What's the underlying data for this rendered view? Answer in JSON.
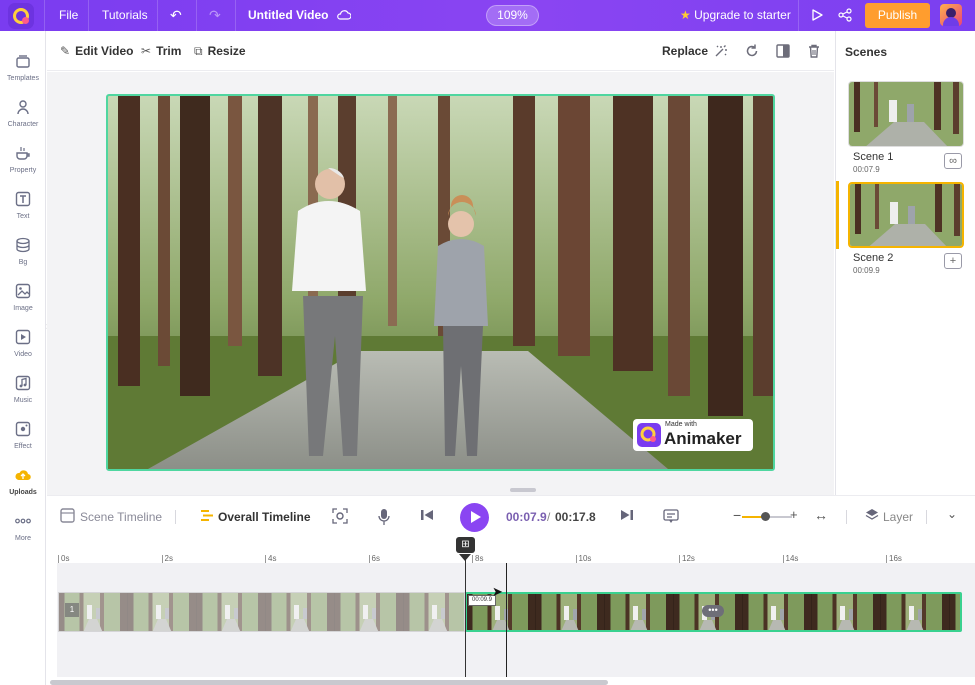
{
  "topbar": {
    "file": "File",
    "tutorials": "Tutorials",
    "project_title": "Untitled Video",
    "zoom": "109%",
    "upgrade": "Upgrade to starter",
    "publish": "Publish"
  },
  "sidebar": {
    "items": [
      {
        "label": "Templates",
        "icon": "templates-icon"
      },
      {
        "label": "Character",
        "icon": "character-icon"
      },
      {
        "label": "Property",
        "icon": "property-icon"
      },
      {
        "label": "Text",
        "icon": "text-icon"
      },
      {
        "label": "Bg",
        "icon": "bg-icon"
      },
      {
        "label": "Image",
        "icon": "image-icon"
      },
      {
        "label": "Video",
        "icon": "video-icon"
      },
      {
        "label": "Music",
        "icon": "music-icon"
      },
      {
        "label": "Effect",
        "icon": "effect-icon"
      },
      {
        "label": "Uploads",
        "icon": "uploads-icon"
      },
      {
        "label": "More",
        "icon": "more-icon"
      }
    ],
    "active": "Uploads"
  },
  "toolbar": {
    "edit_video": "Edit Video",
    "trim": "Trim",
    "resize": "Resize",
    "replace": "Replace"
  },
  "canvas": {
    "watermark_small": "Made with",
    "watermark_brand": "Animaker"
  },
  "scenes": {
    "title": "Scenes",
    "items": [
      {
        "name": "Scene 1",
        "duration": "00:07.9",
        "selected": false
      },
      {
        "name": "Scene 2",
        "duration": "00:09.9",
        "selected": true
      }
    ]
  },
  "timeline": {
    "scene_timeline": "Scene Timeline",
    "overall_timeline": "Overall Timeline",
    "current_time": "00:07.9",
    "separator": "/",
    "total_time": "00:17.8",
    "layer": "Layer",
    "zoom_level": 0.45,
    "ruler": [
      "0s",
      "2s",
      "4s",
      "6s",
      "8s",
      "10s",
      "12s",
      "14s",
      "16s"
    ],
    "track_number": "1",
    "tooltip_time": "00:09.9"
  },
  "colors": {
    "accent_purple": "#8a45f2",
    "publish_orange": "#ff9d2e",
    "selection_green": "#4fd6a0",
    "active_yellow": "#f5b400"
  }
}
